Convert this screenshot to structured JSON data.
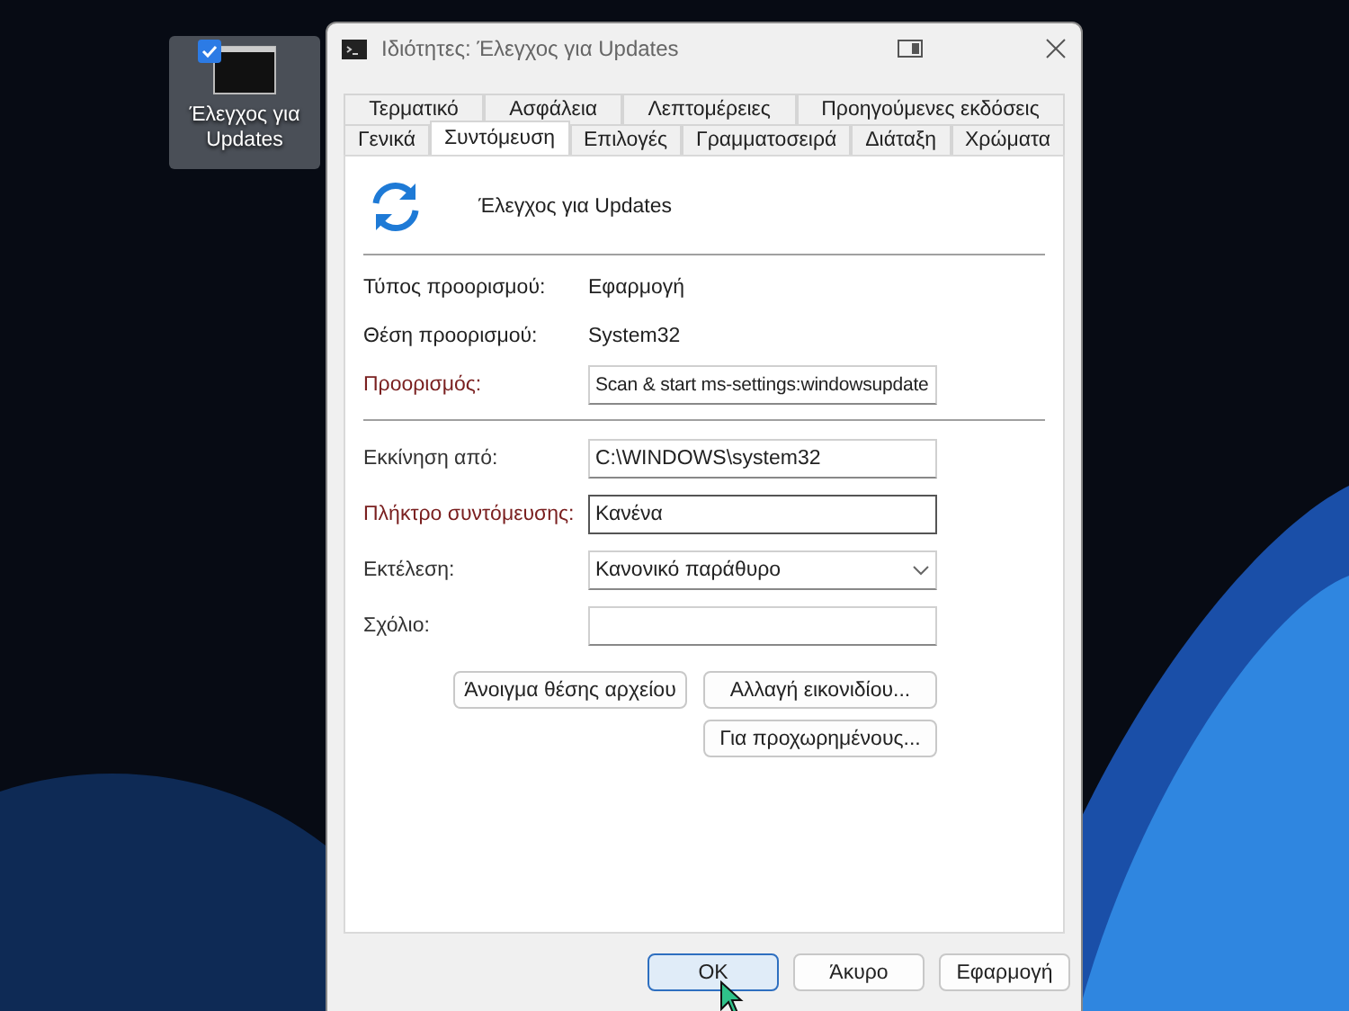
{
  "desktop_icon": {
    "label": "Έλεγχος για Updates",
    "selected": true
  },
  "window": {
    "title": "Ιδιότητες: Έλεγχος για Updates"
  },
  "tab_rows": [
    [
      {
        "label": "Τερματικό",
        "selected": false
      },
      {
        "label": "Ασφάλεια",
        "selected": false
      },
      {
        "label": "Λεπτομέρειες",
        "selected": false
      },
      {
        "label": "Προηγούμενες εκδόσεις",
        "selected": false
      }
    ],
    [
      {
        "label": "Γενικά",
        "selected": false
      },
      {
        "label": "Συντόμευση",
        "selected": true
      },
      {
        "label": "Επιλογές",
        "selected": false
      },
      {
        "label": "Γραμματοσειρά",
        "selected": false
      },
      {
        "label": "Διάταξη",
        "selected": false
      },
      {
        "label": "Χρώματα",
        "selected": false
      }
    ]
  ],
  "shortcut_name": "Έλεγχος για Updates",
  "info_rows": [
    {
      "label": "Τύπος προορισμού:",
      "value": "Εφαρμογή"
    },
    {
      "label": "Θέση προορισμού:",
      "value": "System32"
    }
  ],
  "target": {
    "label": "Προορισμός:",
    "value": "Scan & start ms-settings:windowsupdate",
    "color": "#7a2020"
  },
  "fields": [
    {
      "kind": "text",
      "label": "Εκκίνηση από:",
      "value": "C:\\WINDOWS\\system32",
      "color": "#333333",
      "focused": false
    },
    {
      "kind": "text",
      "label": "Πλήκτρο συντόμευσης:",
      "value": "Κανένα",
      "color": "#7a2020",
      "focused": true
    },
    {
      "kind": "select",
      "label": "Εκτέλεση:",
      "value": "Κανονικό παράθυρο",
      "color": "#333333",
      "focused": false
    },
    {
      "kind": "text",
      "label": "Σχόλιο:",
      "color": "#333333",
      "focused": false
    }
  ],
  "action_buttons": [
    [
      "Άνοιγμα θέσης αρχείου",
      "Αλλαγή εικονιδίου..."
    ],
    [
      "Για προχωρημένους..."
    ]
  ],
  "footer_buttons": [
    {
      "label": "OK",
      "selected": true
    },
    {
      "label": "Άκυρο",
      "selected": false
    },
    {
      "label": "Εφαρμογή",
      "selected": false
    }
  ]
}
